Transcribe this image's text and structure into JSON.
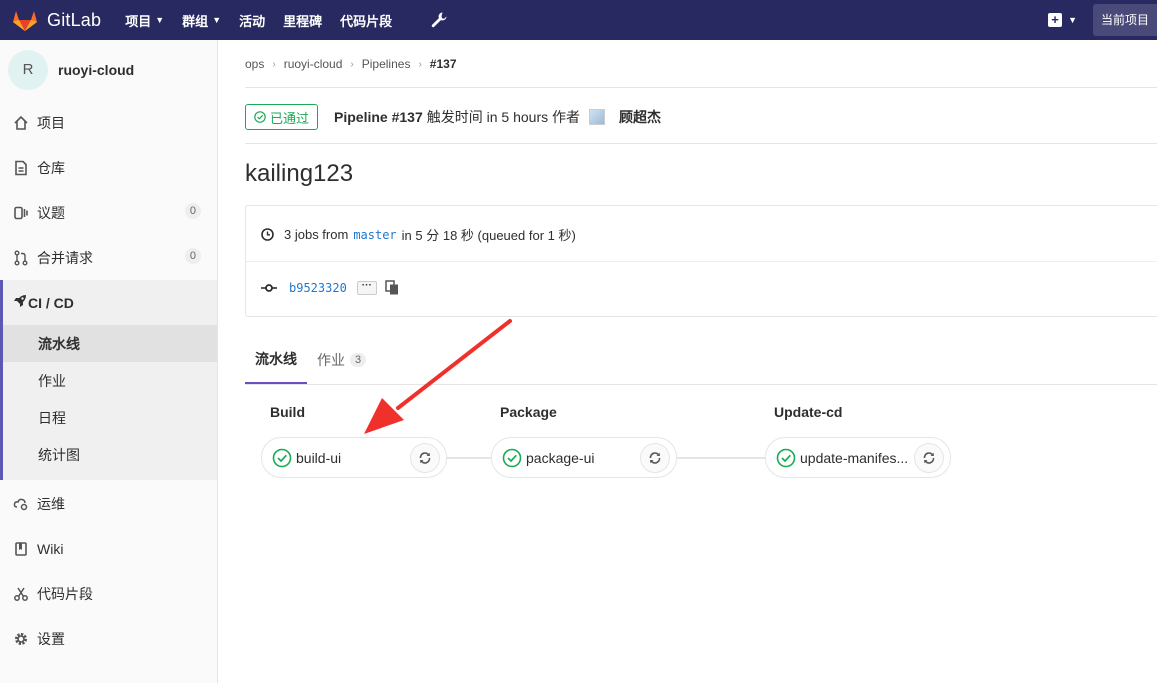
{
  "topbar": {
    "brand": "GitLab",
    "nav": [
      {
        "label": "项目",
        "caret": true
      },
      {
        "label": "群组",
        "caret": true
      },
      {
        "label": "活动",
        "caret": false
      },
      {
        "label": "里程碑",
        "caret": false
      },
      {
        "label": "代码片段",
        "caret": false
      }
    ],
    "current_project": "当前项目",
    "colors": {
      "background": "#292961",
      "logo": "#fc6d26"
    }
  },
  "sidebar": {
    "project_initial": "R",
    "project_name": "ruoyi-cloud",
    "items": [
      {
        "label": "项目",
        "icon": "home-icon"
      },
      {
        "label": "仓库",
        "icon": "document-icon"
      },
      {
        "label": "议题",
        "icon": "issues-icon",
        "count": "0"
      },
      {
        "label": "合并请求",
        "icon": "merge-request-icon",
        "count": "0"
      },
      {
        "label": "CI / CD",
        "icon": "rocket-icon"
      }
    ],
    "cicd_sub": [
      "流水线",
      "作业",
      "日程",
      "统计图"
    ],
    "bottom_items": [
      {
        "label": "运维",
        "icon": "cloud-gear-icon"
      },
      {
        "label": "Wiki",
        "icon": "book-icon"
      },
      {
        "label": "代码片段",
        "icon": "scissors-icon"
      },
      {
        "label": "设置",
        "icon": "gear-icon"
      }
    ],
    "accent": "#5e58b5"
  },
  "breadcrumb": [
    "ops",
    "ruoyi-cloud",
    "Pipelines",
    "#137"
  ],
  "pipeline": {
    "status": "已通过",
    "title": "Pipeline #137",
    "trigger_text": "触发时间 in 5 hours 作者",
    "author": "顾超杰",
    "status_color": "#1aaa55"
  },
  "commit_title": "kailing123",
  "info": {
    "jobs_prefix": "3 jobs from",
    "branch": "master",
    "jobs_suffix": "in 5 分 18 秒 (queued for 1 秒)",
    "sha": "b9523320",
    "ellipsis": "···"
  },
  "tabs": [
    {
      "label": "流水线",
      "active": true
    },
    {
      "label": "作业",
      "count": "3",
      "active": false
    }
  ],
  "stages": [
    {
      "title": "Build",
      "job": "build-ui"
    },
    {
      "title": "Package",
      "job": "package-ui"
    },
    {
      "title": "Update-cd",
      "job": "update-manifes..."
    }
  ],
  "annotation": {
    "color": "#f0302a"
  }
}
